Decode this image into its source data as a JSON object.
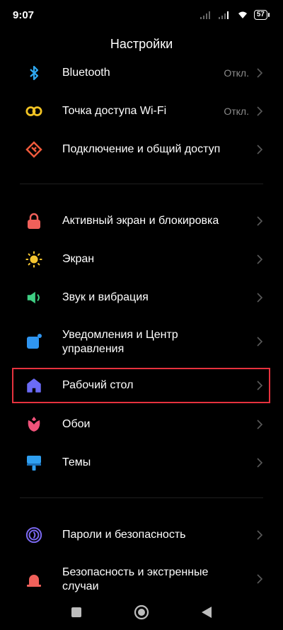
{
  "status": {
    "time": "9:07",
    "battery": "57"
  },
  "header": {
    "title": "Настройки"
  },
  "settings": {
    "bluetooth": {
      "label": "Bluetooth",
      "value": "Откл.",
      "color": "#2fa8f0"
    },
    "hotspot": {
      "label": "Точка доступа Wi-Fi",
      "value": "Откл.",
      "color": "#f2c424"
    },
    "connection": {
      "label": "Подключение и общий доступ",
      "color": "#ef5a3c"
    },
    "lockscreen": {
      "label": "Активный экран и блокировка",
      "color": "#f0605a"
    },
    "display": {
      "label": "Экран",
      "color": "#f5c530"
    },
    "sound": {
      "label": "Звук и вибрация",
      "color": "#3fcf84"
    },
    "notifications": {
      "label": "Уведомления и Центр управления",
      "label_line1": "Уведомления и Центр",
      "label_line2": "управления",
      "color": "#2f95f0"
    },
    "home": {
      "label": "Рабочий стол",
      "color": "#6b6bf5"
    },
    "wallpaper": {
      "label": "Обои",
      "color": "#f0527a"
    },
    "themes": {
      "label": "Темы",
      "color": "#2f9ff0"
    },
    "passwords": {
      "label": "Пароли и безопасность",
      "color": "#7a68f0"
    },
    "safety": {
      "label": "Безопасность и экстренные случаи",
      "label_line1": "Безопасность и экстренные",
      "label_line2": "случаи",
      "color": "#f0605a"
    }
  },
  "accent": {
    "highlight": "#e6323e"
  },
  "icons": {
    "bluetooth": "bluetooth-icon",
    "hotspot": "hotspot-icon",
    "connection": "connection-icon",
    "lockscreen": "lock-icon",
    "display": "sun-icon",
    "sound": "speaker-icon",
    "notifications": "notification-icon",
    "home": "home-icon",
    "wallpaper": "flower-icon",
    "themes": "brush-icon",
    "passwords": "fingerprint-icon",
    "safety": "siren-icon"
  }
}
